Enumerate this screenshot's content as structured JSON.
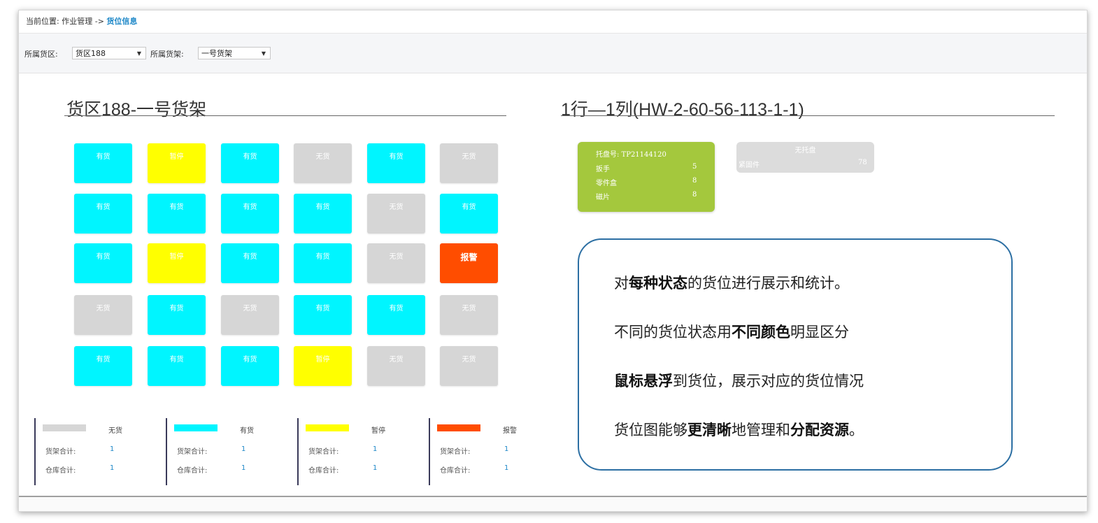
{
  "breadcrumb": {
    "label": "当前位置:",
    "parent": "作业管理",
    "arrow": "->",
    "current": "货位信息"
  },
  "filters": {
    "zone_label": "所属货区:",
    "zone_value": "货区188",
    "shelf_label": "所属货架:",
    "shelf_value": "一号货架"
  },
  "left_title": "货区188-一号货架",
  "right_title": "1行—1列(HW-2-60-56-113-1-1)",
  "status_colors": {
    "empty": "#d6d6d6",
    "stocked": "#00f5ff",
    "paused": "#ffff00",
    "alarm": "#ff4d00"
  },
  "grid": [
    [
      {
        "label": "有货",
        "status": "stocked"
      },
      {
        "label": "暂停",
        "status": "paused"
      },
      {
        "label": "有货",
        "status": "stocked"
      },
      {
        "label": "无货",
        "status": "empty"
      },
      {
        "label": "有货",
        "status": "stocked"
      },
      {
        "label": "无货",
        "status": "empty"
      }
    ],
    [
      {
        "label": "有货",
        "status": "stocked"
      },
      {
        "label": "有货",
        "status": "stocked"
      },
      {
        "label": "有货",
        "status": "stocked"
      },
      {
        "label": "有货",
        "status": "stocked"
      },
      {
        "label": "无货",
        "status": "empty"
      },
      {
        "label": "有货",
        "status": "stocked"
      }
    ],
    [
      {
        "label": "有货",
        "status": "stocked"
      },
      {
        "label": "暂停",
        "status": "paused"
      },
      {
        "label": "有货",
        "status": "stocked"
      },
      {
        "label": "有货",
        "status": "stocked"
      },
      {
        "label": "无货",
        "status": "empty"
      },
      {
        "label": "报警",
        "status": "alarm"
      }
    ],
    [
      {
        "label": "无货",
        "status": "empty"
      },
      {
        "label": "有货",
        "status": "stocked"
      },
      {
        "label": "无货",
        "status": "empty"
      },
      {
        "label": "有货",
        "status": "stocked"
      },
      {
        "label": "有货",
        "status": "stocked"
      },
      {
        "label": "无货",
        "status": "empty"
      }
    ],
    [
      {
        "label": "有货",
        "status": "stocked"
      },
      {
        "label": "有货",
        "status": "stocked"
      },
      {
        "label": "有货",
        "status": "stocked"
      },
      {
        "label": "暂停",
        "status": "paused"
      },
      {
        "label": "无货",
        "status": "empty"
      },
      {
        "label": "无货",
        "status": "empty"
      }
    ]
  ],
  "legend": [
    {
      "name": "无货",
      "status": "empty",
      "shelf_label": "货架合计:",
      "shelf_count": "1",
      "warehouse_label": "仓库合计:",
      "warehouse_count": "1"
    },
    {
      "name": "有货",
      "status": "stocked",
      "shelf_label": "货架合计:",
      "shelf_count": "1",
      "warehouse_label": "仓库合计:",
      "warehouse_count": "1"
    },
    {
      "name": "暂停",
      "status": "paused",
      "shelf_label": "货架合计:",
      "shelf_count": "1",
      "warehouse_label": "仓库合计:",
      "warehouse_count": "1"
    },
    {
      "name": "报警",
      "status": "alarm",
      "shelf_label": "货架合计:",
      "shelf_count": "1",
      "warehouse_label": "仓库合计:",
      "warehouse_count": "1"
    }
  ],
  "pallet": {
    "number": "托盘号: TP21144120",
    "items": [
      {
        "name": "扳手",
        "qty": "5"
      },
      {
        "name": "零件盒",
        "qty": "8"
      },
      {
        "name": "磁片",
        "qty": "8"
      }
    ]
  },
  "no_pallet": {
    "title": "无托盘",
    "item": "紧固件",
    "qty": "78"
  },
  "callout": {
    "line1": [
      {
        "t": "对",
        "b": false
      },
      {
        "t": "每种状态",
        "b": true
      },
      {
        "t": "的货位进行展示和统计。",
        "b": false
      }
    ],
    "line2": [
      {
        "t": "不同的货位状态用",
        "b": false
      },
      {
        "t": "不同颜色",
        "b": true
      },
      {
        "t": "明显区分",
        "b": false
      }
    ],
    "line3": [
      {
        "t": "鼠标悬浮",
        "b": true
      },
      {
        "t": "到货位，展示对应的货位情况",
        "b": false
      }
    ],
    "line4": [
      {
        "t": "货位图能够",
        "b": false
      },
      {
        "t": "更清晰",
        "b": true
      },
      {
        "t": "地管理和",
        "b": false
      },
      {
        "t": "分配资源",
        "b": true
      },
      {
        "t": "。",
        "b": false
      }
    ]
  }
}
